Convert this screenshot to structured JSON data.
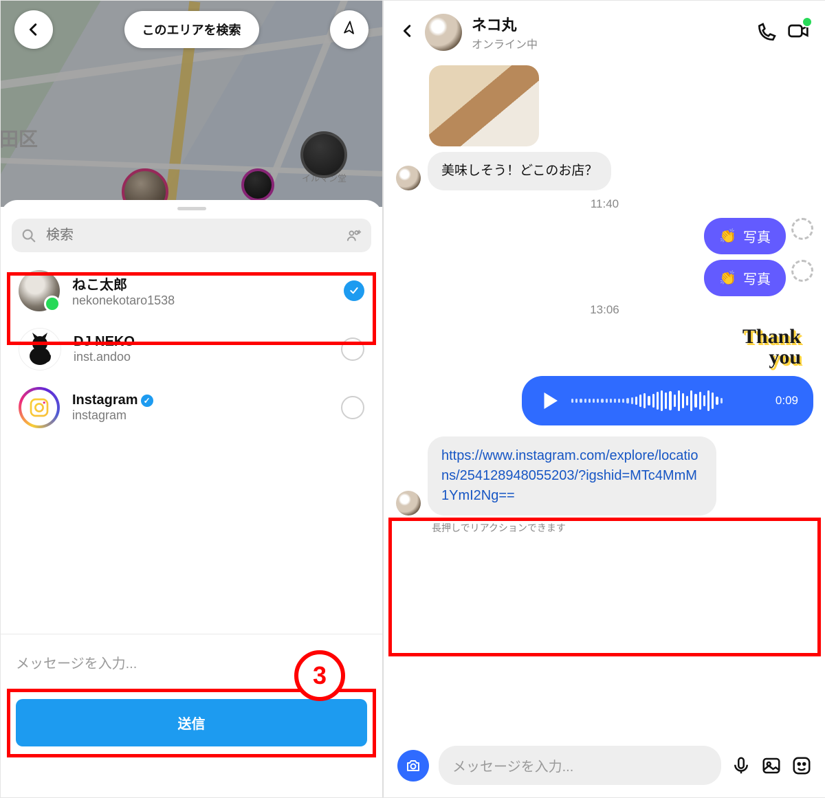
{
  "left": {
    "search_area_label": "このエリアを検索",
    "district_label": "代田区",
    "pin_label": "イルマン堂",
    "sheet": {
      "search_placeholder": "検索",
      "contacts": [
        {
          "name": "ねこ太郎",
          "username": "nekonekotaro1538",
          "selected": true
        },
        {
          "name": "DJ NEKO",
          "username": "inst.andoo",
          "selected": false
        },
        {
          "name": "Instagram",
          "username": "instagram",
          "verified": true,
          "selected": false
        }
      ],
      "message_placeholder": "メッセージを入力...",
      "send_label": "送信"
    },
    "step_badge": "3"
  },
  "right": {
    "header": {
      "name": "ネコ丸",
      "status": "オンライン中"
    },
    "messages": {
      "incoming_text": "美味しそう！どこのお店？",
      "t1": "11:40",
      "photo_chip": "写真",
      "t2": "13:06",
      "thank1": "Thank",
      "thank2": "you",
      "voice_time": "0:09",
      "link_text": "https://www.instagram.com/explore/locations/254128948055203/?igshid=MTc4MmM1YmI2Ng==",
      "reaction_hint": "長押しでリアクションできます"
    },
    "compose_placeholder": "メッセージを入力..."
  }
}
